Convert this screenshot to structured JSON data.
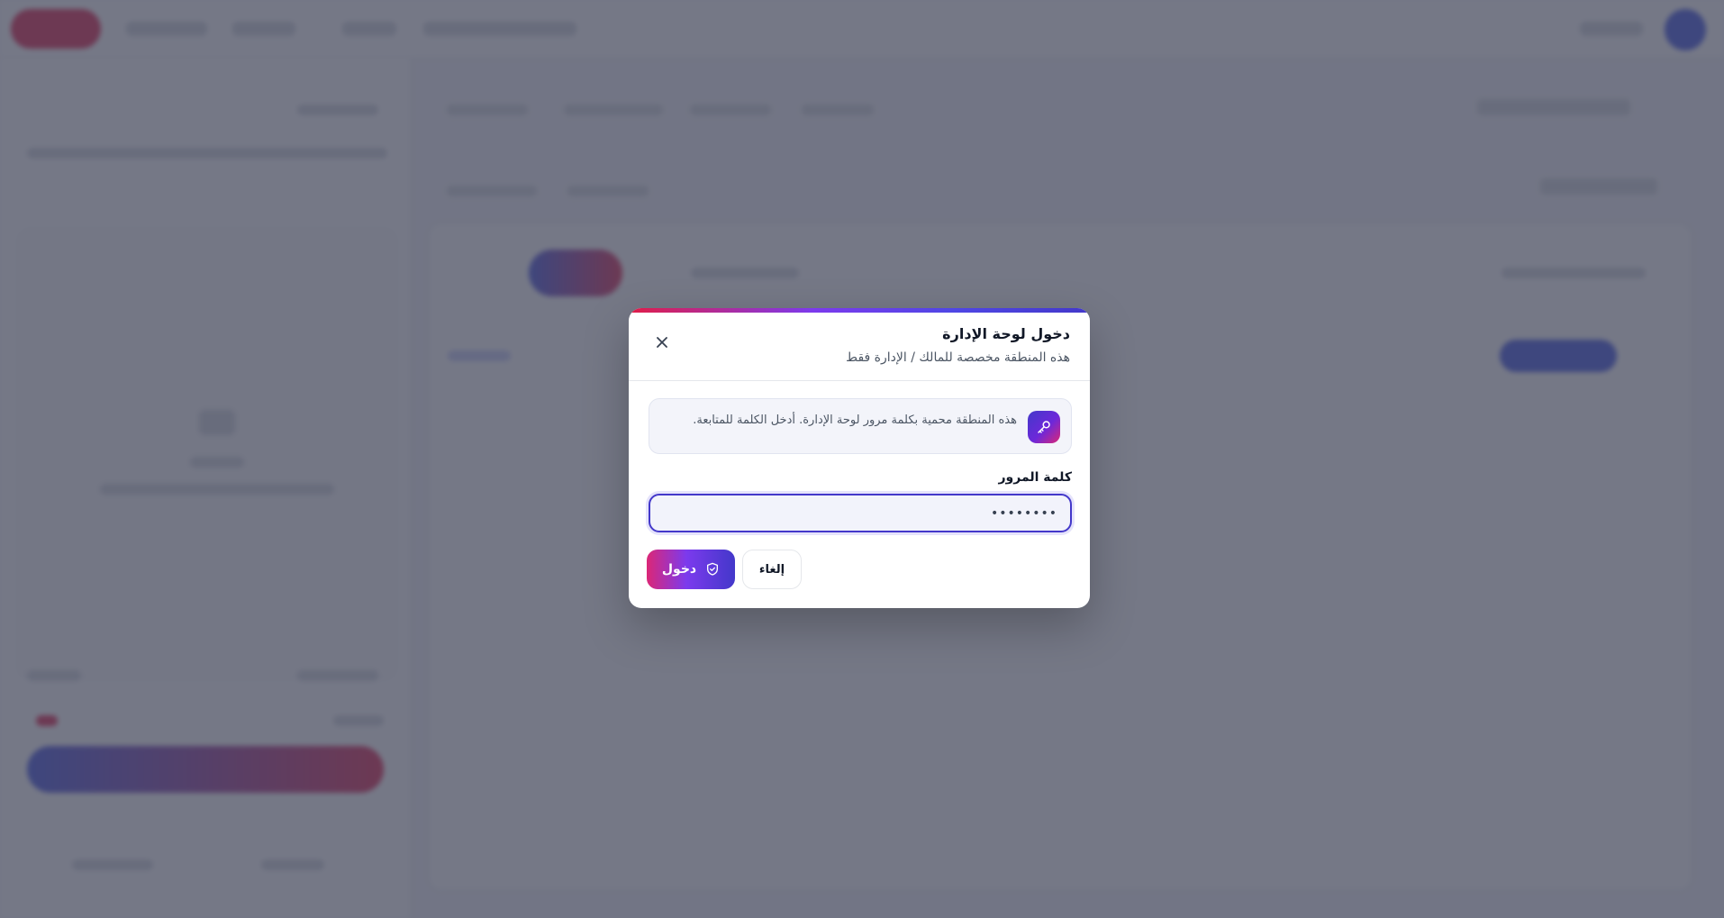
{
  "modal": {
    "title": "دخول لوحة الإدارة",
    "subtitle": "هذه المنطقة مخصصة للمالك / الإدارة فقط",
    "info_text": "هذه المنطقة محمية بكلمة مرور لوحة الإدارة. أدخل الكلمة للمتابعة.",
    "info_icon": "key-icon",
    "password_label": "كلمة المرور",
    "password_value": "••••••••",
    "login_label": "دخول",
    "login_icon": "shield-check-icon",
    "cancel_label": "إلغاء",
    "close_icon": "close-icon"
  },
  "colors": {
    "primary": "#4338ca",
    "accent": "#db2777",
    "overlay": "#404458"
  }
}
